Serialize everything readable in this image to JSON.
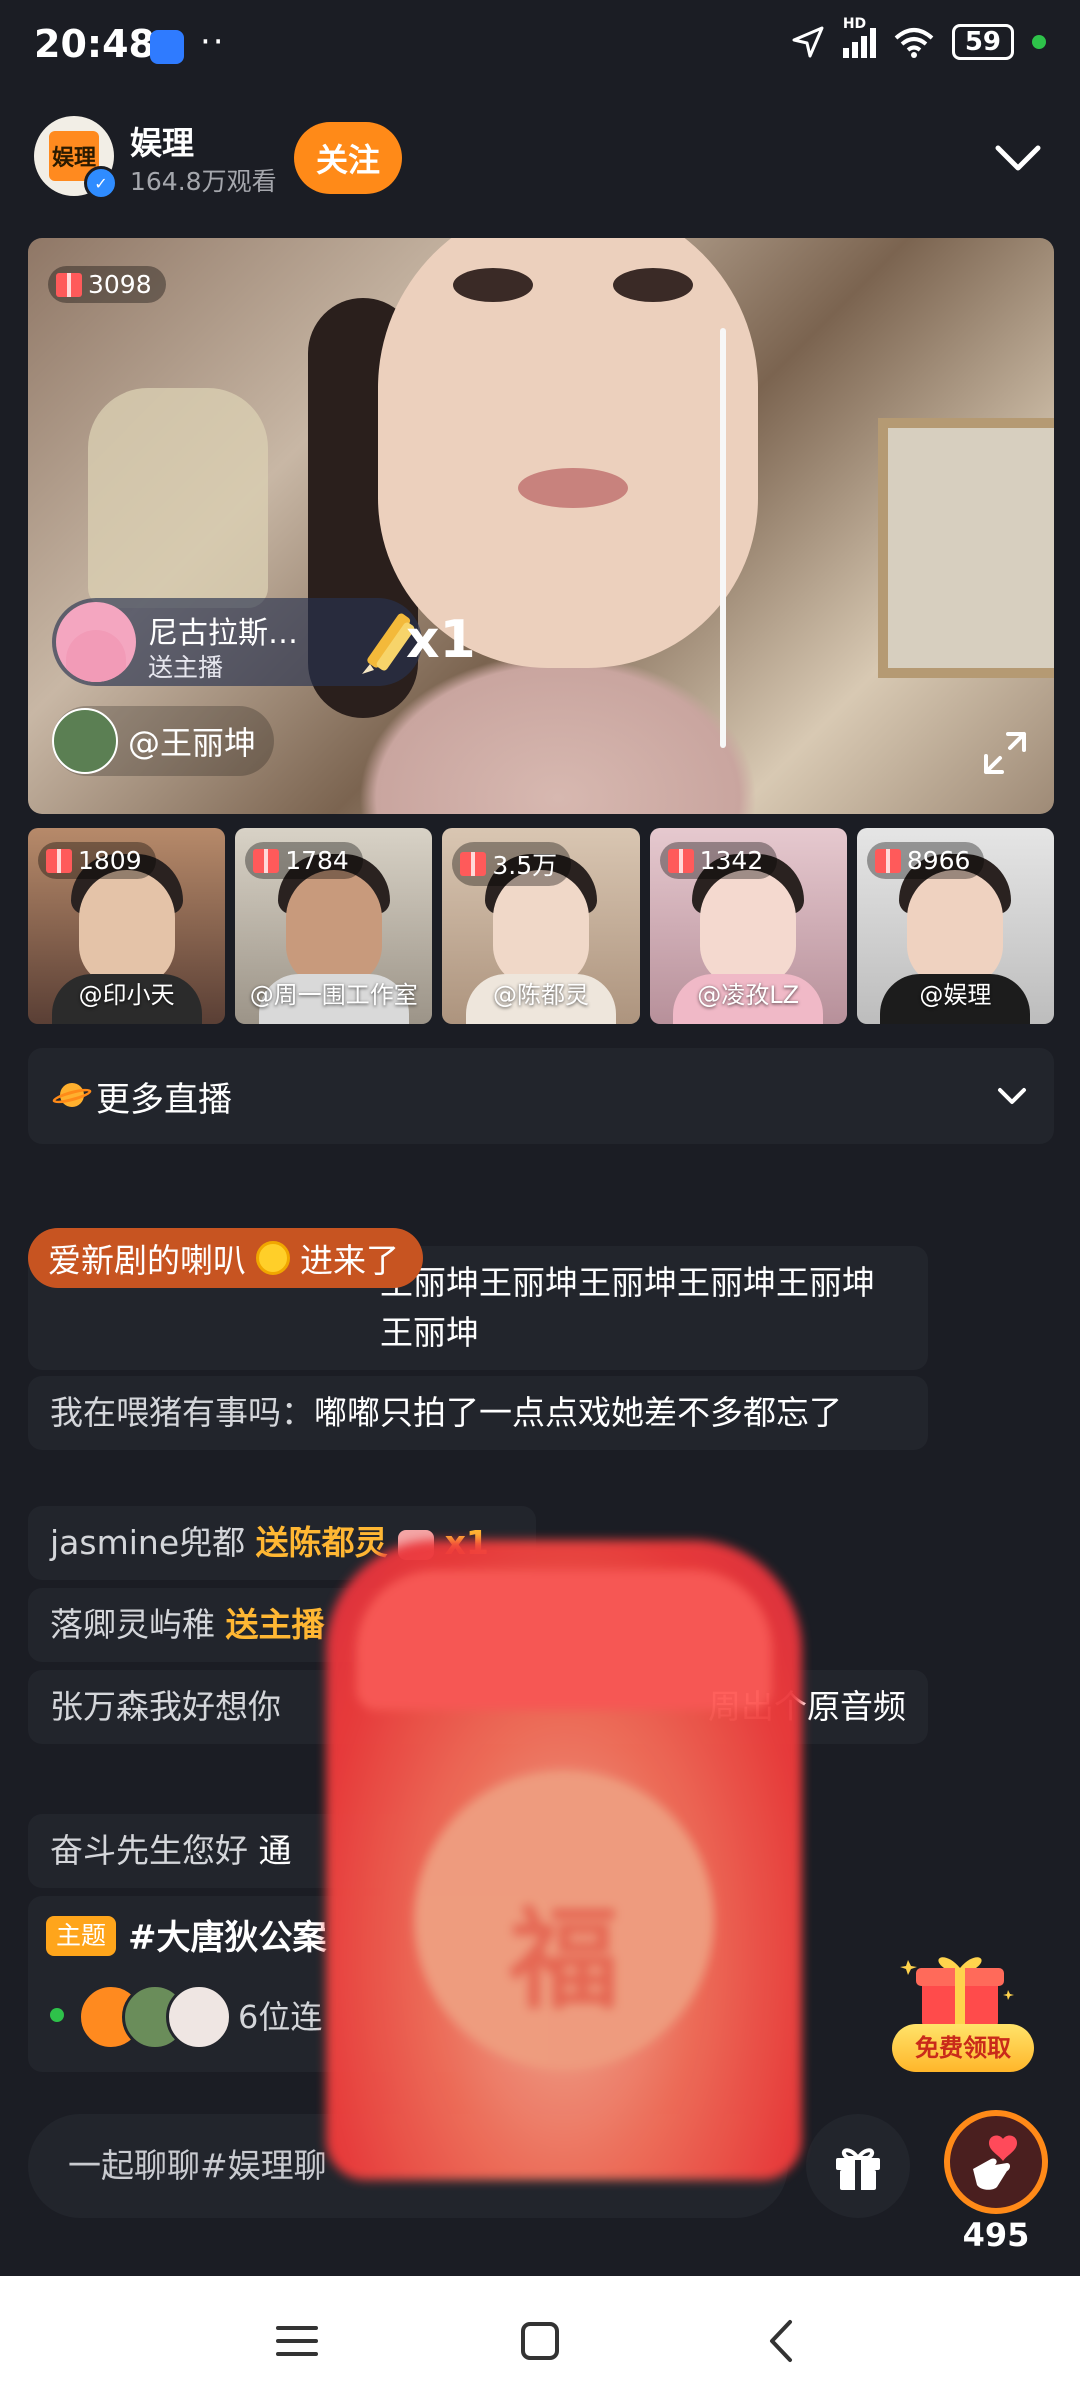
{
  "status_bar": {
    "time": "20:48",
    "signal_label": "HD",
    "battery": "59",
    "icons": [
      "app-icon",
      "more-dots-icon",
      "location-arrow-icon",
      "signal-icon",
      "wifi-icon",
      "battery-icon"
    ]
  },
  "header": {
    "anchor_name": "娱理",
    "views": "164.8万观看",
    "follow_label": "关注",
    "logo_text": "娱理"
  },
  "main_video": {
    "gift_count": "3098",
    "gift_notice": {
      "sender": "尼古拉斯…",
      "subtitle": "送主播",
      "count": "x1"
    },
    "mention": "@王丽坤"
  },
  "thumbnails": [
    {
      "gift": "1809",
      "name": "@印小天"
    },
    {
      "gift": "1784",
      "name": "@周一围工作室"
    },
    {
      "gift": "3.5万",
      "name": "@陈都灵"
    },
    {
      "gift": "1342",
      "name": "@凌孜LZ"
    },
    {
      "gift": "8966",
      "name": "@娱理"
    }
  ],
  "more_live": {
    "label": "更多直播"
  },
  "enter_banner": {
    "user": "爱新剧的喇叭",
    "action": "进来了"
  },
  "chat": [
    {
      "user": "",
      "highlight": "",
      "content": "王丽坤王丽坤王丽坤王丽坤王丽坤王丽坤"
    },
    {
      "user": "我在喂猪有事吗：",
      "highlight": "",
      "content": "嘟嘟只拍了一点点戏她差不多都忘了"
    },
    {
      "user": "jasmine兜都",
      "highlight": "送陈都灵",
      "content": "x1"
    },
    {
      "user": "落卿灵屿稚",
      "highlight": "送主播",
      "content": ""
    },
    {
      "user": "张万森我好想你",
      "highlight": "",
      "content": "周出个原音频"
    },
    {
      "user": "奋斗先生您好",
      "highlight": "",
      "content": "通"
    }
  ],
  "topic": {
    "tag": "主题",
    "title": "#大唐狄公案",
    "count": "6位连"
  },
  "free_gift": {
    "label": "免费领取"
  },
  "red_packet": {
    "char": "福"
  },
  "bottom_bar": {
    "input_placeholder": "一起聊聊#娱理聊",
    "like_count": "495"
  },
  "colors": {
    "accent": "#ff8a18",
    "highlight": "#ffb733",
    "background": "#1b1d24",
    "bubble": "#22252c"
  }
}
